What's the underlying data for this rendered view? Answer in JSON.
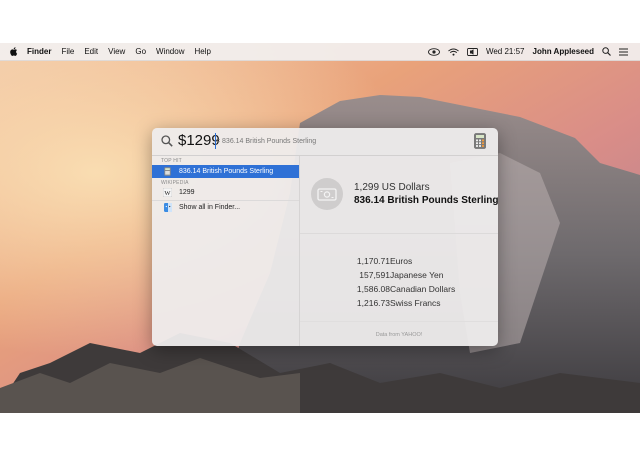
{
  "menubar": {
    "apple_icon": "apple-icon",
    "app_name": "Finder",
    "items": [
      "File",
      "Edit",
      "View",
      "Go",
      "Window",
      "Help"
    ],
    "status": {
      "clock": "Wed 21:57",
      "user": "John Appleseed",
      "icons": [
        "eye-icon",
        "wifi-icon",
        "volume-icon"
      ]
    }
  },
  "spotlight": {
    "query": "$1299",
    "hint": "= 836.14 British Pounds Sterling",
    "sections": {
      "top_hit": "TOP HIT",
      "wikipedia": "WIKIPEDIA"
    },
    "results": [
      {
        "label": "836.14 British Pounds Sterling",
        "icon": "calculator-icon",
        "selected": true
      },
      {
        "label": "1299",
        "icon": "wikipedia-icon",
        "selected": false
      },
      {
        "label": "Show all in Finder...",
        "icon": "finder-icon",
        "selected": false
      }
    ],
    "preview": {
      "icon": "money-icon",
      "from_amount": "1,299 US Dollars",
      "to_amount": "836.14 British Pounds Sterling",
      "conversions": [
        {
          "value": "1,170.71",
          "currency": "Euros"
        },
        {
          "value": "157,591",
          "currency": "Japanese Yen"
        },
        {
          "value": "1,586.08",
          "currency": "Canadian Dollars"
        },
        {
          "value": "1,216.73",
          "currency": "Swiss Francs"
        }
      ],
      "footer": "Data from YAHOO!"
    }
  },
  "colors": {
    "selection": "#2f71d6",
    "panel": "#eeecec"
  }
}
